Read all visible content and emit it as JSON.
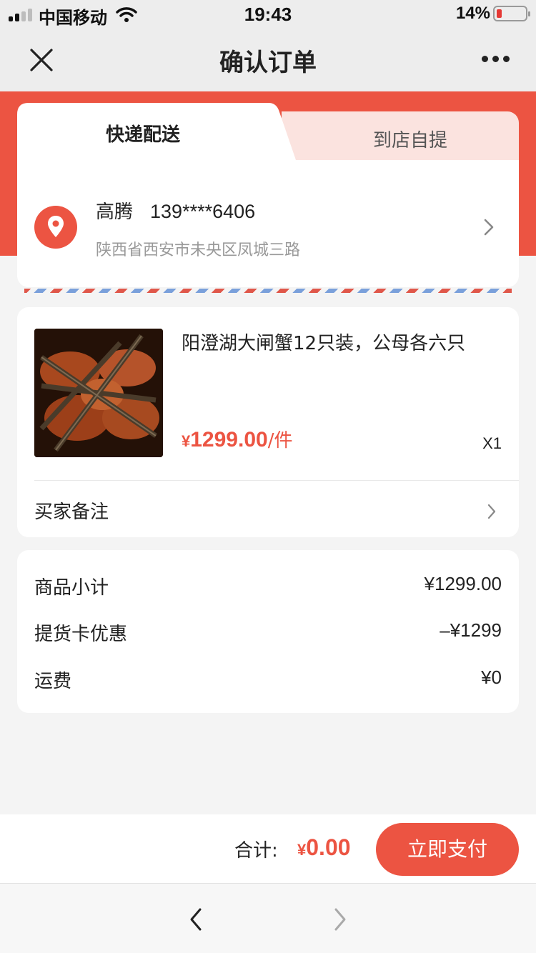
{
  "status_bar": {
    "carrier": "中国移动",
    "time": "19:43",
    "battery_percent": "14%",
    "battery_level": 0.14,
    "signal_bars": 2,
    "icons": [
      "signal-icon",
      "wifi-icon",
      "battery-icon"
    ]
  },
  "navbar": {
    "title": "确认订单",
    "icons": [
      "close-icon",
      "more-icon"
    ]
  },
  "delivery": {
    "tabs": [
      {
        "label": "快递配送",
        "active": true
      },
      {
        "label": "到店自提",
        "active": false
      }
    ],
    "recipient_name": "高腾",
    "recipient_phone": "139****6406",
    "address": "陕西省西安市未央区凤城三路",
    "icons": [
      "location-pin-icon",
      "chevron-right-icon"
    ]
  },
  "product": {
    "title": "阳澄湖大闸蟹12只装，公母各六只",
    "price_symbol": "¥",
    "price": "1299.00",
    "unit": "/件",
    "quantity": "X1",
    "image": "hairy-crab-image"
  },
  "buyer_note": {
    "label": "买家备注"
  },
  "summary": {
    "rows": [
      {
        "label": "商品小计",
        "value": "¥1299.00"
      },
      {
        "label": "提货卡优惠",
        "value": "–¥1299"
      },
      {
        "label": "运费",
        "value": "¥0"
      }
    ]
  },
  "pay_bar": {
    "total_label": "合计:",
    "currency": "¥",
    "total": "0.00",
    "pay_button": "立即支付"
  },
  "browser_nav": {
    "icons": [
      "back-arrow-icon",
      "forward-arrow-icon"
    ]
  },
  "colors": {
    "accent": "#ec5442",
    "tab_inactive_bg": "#fbe3df",
    "page_bg": "#f4f4f4"
  }
}
